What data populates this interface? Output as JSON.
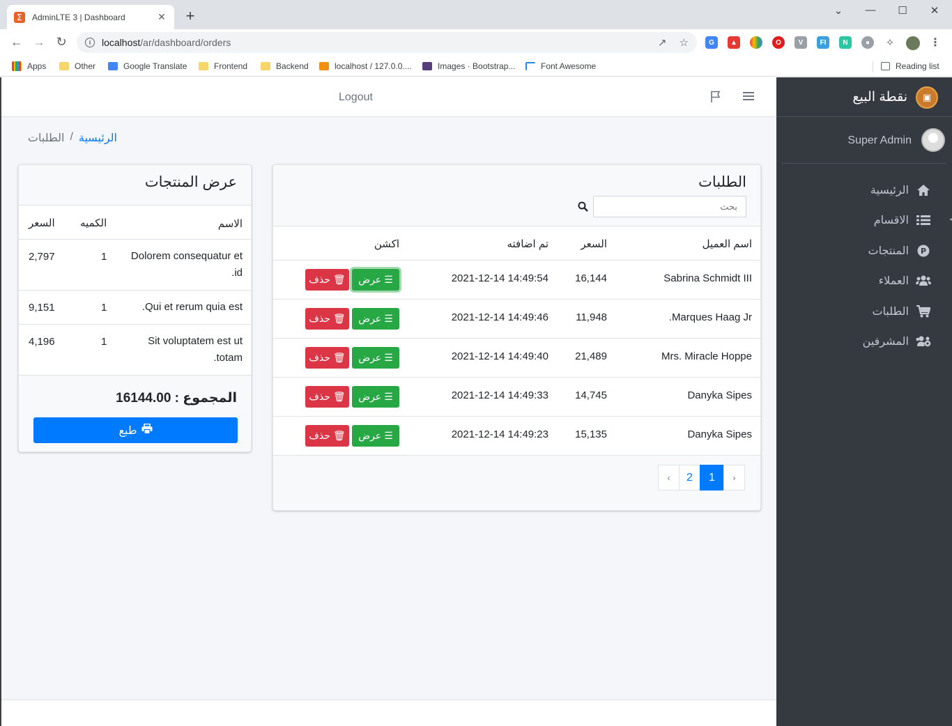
{
  "browser": {
    "tab_title": "AdminLTE 3 | Dashboard",
    "url_host": "localhost",
    "url_path": "/ar/dashboard/orders",
    "bookmarks": [
      "Apps",
      "Other",
      "Google Translate",
      "Frontend",
      "Backend",
      "localhost / 127.0.0....",
      "Images · Bootstrap...",
      "Font Awesome"
    ],
    "reading_list": "Reading list"
  },
  "sidebar": {
    "brand": "نقطة البيع",
    "user": "Super Admin",
    "items": [
      {
        "label": "الرئيسية",
        "icon": "home-icon"
      },
      {
        "label": "الاقسام",
        "icon": "list-icon"
      },
      {
        "label": "المنتجات",
        "icon": "product-p-icon"
      },
      {
        "label": "العملاء",
        "icon": "users-icon"
      },
      {
        "label": "الطلبات",
        "icon": "cart-icon"
      },
      {
        "label": "المشرفين",
        "icon": "users-cog-icon"
      }
    ]
  },
  "topnav": {
    "logout": "Logout"
  },
  "breadcrumb": {
    "home": "الرئيسية",
    "separator": "/",
    "current": "الطلبات"
  },
  "orders": {
    "title": "الطلبات",
    "search_placeholder": "بحث",
    "columns": {
      "client": "اسم العميل",
      "price": "السعر",
      "added": "تم اضافته",
      "action": "اكشن"
    },
    "view_label": "عرض",
    "delete_label": "حذف",
    "rows": [
      {
        "client": "Sabrina Schmidt III",
        "price": "16,144",
        "added": "2021-12-14 14:49:54"
      },
      {
        "client": "Marques Haag Jr.",
        "price": "11,948",
        "added": "2021-12-14 14:49:46"
      },
      {
        "client": "Mrs. Miracle Hoppe",
        "price": "21,489",
        "added": "2021-12-14 14:49:40"
      },
      {
        "client": "Danyka Sipes",
        "price": "14,745",
        "added": "2021-12-14 14:49:33"
      },
      {
        "client": "Danyka Sipes",
        "price": "15,135",
        "added": "2021-12-14 14:49:23"
      }
    ],
    "pagination": {
      "prev": "‹",
      "pages": [
        "1",
        "2"
      ],
      "active": "1",
      "next": "›"
    }
  },
  "products": {
    "title": "عرض المنتجات",
    "columns": {
      "name": "الاسم",
      "qty": "الكميه",
      "price": "السعر"
    },
    "rows": [
      {
        "name": "Dolorem consequatur et id.",
        "qty": "1",
        "price": "2,797"
      },
      {
        "name": "Qui et rerum quia est.",
        "qty": "1",
        "price": "9,151"
      },
      {
        "name": "Sit voluptatem est ut totam.",
        "qty": "1",
        "price": "4,196"
      }
    ],
    "total": "المجموع : 16144.00",
    "print_label": "طبع"
  },
  "colors": {
    "sidebar": "#343a40",
    "primary": "#007bff",
    "success": "#28a745",
    "danger": "#dc3545"
  }
}
